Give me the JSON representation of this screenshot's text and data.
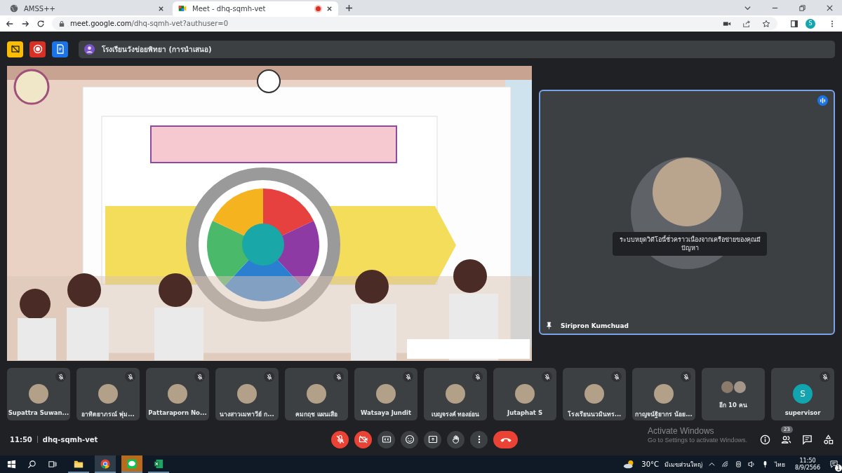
{
  "browser": {
    "tabs": [
      {
        "title": "AMSS++",
        "selected": false,
        "recording": false
      },
      {
        "title": "Meet - dhq-sqmh-vet",
        "selected": true,
        "recording": true
      }
    ],
    "url": {
      "host": "meet.google.com",
      "path": "/dhq-sqmh-vet?authuser=0"
    },
    "profile_initial": "S"
  },
  "meet": {
    "presenter_bar": {
      "text": "โรงเรียนวังข่อยพิทยา (การนำเสนอ)"
    },
    "pinned_tile": {
      "name": "Siripron Kumchuad",
      "notice": "ระบบหยุดวิดีโอนี้ชั่วคราวเนื่องจากเครือข่ายของคุณมีปัญหา",
      "speaking": true
    },
    "participants": [
      {
        "kind": "photo",
        "name": "Supattra Suwan...",
        "muted": true
      },
      {
        "kind": "photo",
        "name": "อาทิตยาภรณ์ พุ่ม...",
        "muted": true
      },
      {
        "kind": "photo",
        "name": "Pattaraporn No...",
        "muted": true
      },
      {
        "kind": "photo",
        "name": "นางสาวเมทาวีย์ ก...",
        "muted": true
      },
      {
        "kind": "photo",
        "name": "คมกฤช แผนเสือ",
        "muted": true
      },
      {
        "kind": "photo",
        "name": "Watsaya Jundit",
        "muted": true
      },
      {
        "kind": "photo",
        "name": "เบญจรงค์ ทองอ่อน",
        "muted": true
      },
      {
        "kind": "photo",
        "name": "Jutaphat S",
        "muted": true
      },
      {
        "kind": "photo",
        "name": "โรงเรียนนวมินทร...",
        "muted": true
      },
      {
        "kind": "photo",
        "name": "กาญจน์ฐิยากร น้อย...",
        "muted": true
      },
      {
        "kind": "more",
        "name": "อีก 10 คน",
        "muted": false
      },
      {
        "kind": "initial",
        "name": "supervisor",
        "initial": "S",
        "color": "#12a4af",
        "muted": true
      }
    ],
    "meeting_time": "11:50",
    "meeting_code": "dhq-sqmh-vet",
    "controls": {
      "mic_muted": true,
      "camera_off": true
    },
    "people_count": "23"
  },
  "system": {
    "watermark_title": "Activate Windows",
    "watermark_text": "Go to Settings to activate Windows.",
    "weather": "30°C",
    "weather_text": "มีเมฆส่วนใหญ่",
    "language": "ไทย",
    "time": "11:50",
    "date": "8/9/2566",
    "notification_count": "1"
  }
}
